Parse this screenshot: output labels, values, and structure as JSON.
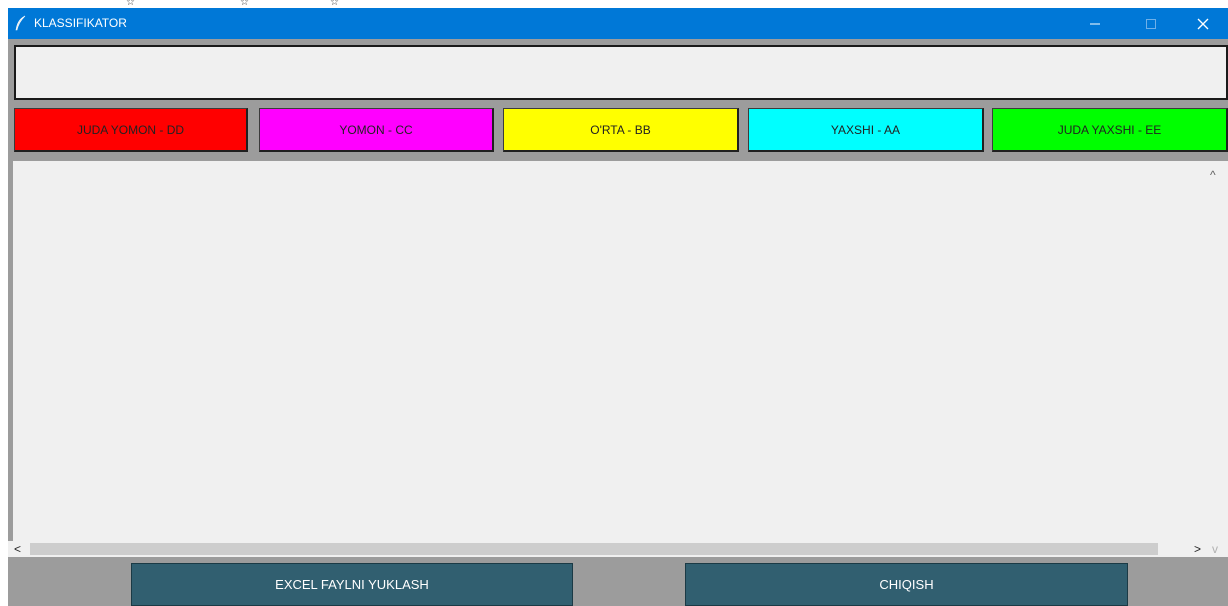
{
  "window": {
    "title": "KLASSIFIKATOR"
  },
  "entry": {
    "value": ""
  },
  "grades": [
    {
      "label": "JUDA YOMON - DD",
      "color": "#ff0000"
    },
    {
      "label": "YOMON - CC",
      "color": "#ff00ff"
    },
    {
      "label": "O'RTA - BB",
      "color": "#ffff00"
    },
    {
      "label": "YAXSHI - AA",
      "color": "#00ffff"
    },
    {
      "label": "JUDA YAXSHI - EE",
      "color": "#00ff00"
    }
  ],
  "actions": {
    "load_label": "EXCEL FAYLNI YUKLASH",
    "exit_label": "CHIQISH"
  },
  "colors": {
    "titlebar": "#0078d7",
    "action_button": "#315f70",
    "background": "#9c9c9c"
  }
}
